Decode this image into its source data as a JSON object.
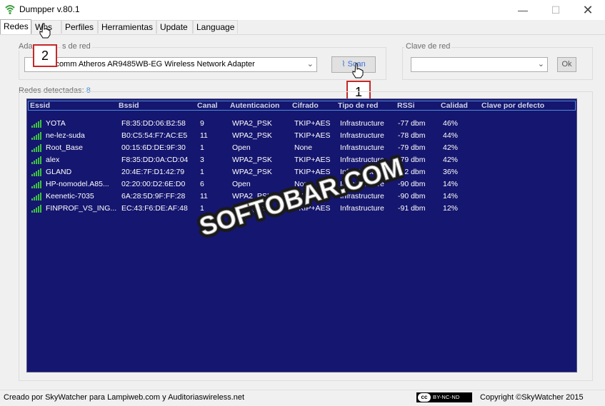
{
  "window": {
    "title": "Dumpper v.80.1",
    "min_glyph": "—",
    "max_glyph": "☐",
    "close_glyph": "✕"
  },
  "tabs": [
    {
      "label": "Redes",
      "active": true
    },
    {
      "label": "Wps",
      "active": false
    },
    {
      "label": "Perfiles",
      "active": false
    },
    {
      "label": "Herramientas",
      "active": false
    },
    {
      "label": "Update",
      "active": false
    },
    {
      "label": "Language",
      "active": false
    }
  ],
  "adapter": {
    "group_label": "Adaptadores de red",
    "group_label_visible": "Ada",
    "group_label_visible_tail": "s de red",
    "selected_value": "lcomm Atheros AR9485WB-EG Wireless Network Adapter",
    "scan_label": "Scan"
  },
  "key": {
    "group_label": "Clave de red",
    "selected_value": "",
    "ok_label": "Ok"
  },
  "callouts": {
    "first": "1",
    "second": "2"
  },
  "networks": {
    "label": "Redes detectadas:",
    "count": "8",
    "columns": [
      "Essid",
      "Bssid",
      "Canal",
      "Autenticacion",
      "Cifrado",
      "Tipo de red",
      "RSSi",
      "Calidad",
      "Clave por defecto"
    ],
    "rows": [
      {
        "essid": "YOTA",
        "bssid": "F8:35:DD:06:B2:58",
        "canal": "9",
        "auth": "WPA2_PSK",
        "cifrado": "TKIP+AES",
        "tipo": "Infrastructure",
        "rssi": "-77 dbm",
        "calidad": "46%",
        "clave": ""
      },
      {
        "essid": "ne-lez-suda",
        "bssid": "B0:C5:54:F7:AC:E5",
        "canal": "11",
        "auth": "WPA2_PSK",
        "cifrado": "TKIP+AES",
        "tipo": "Infrastructure",
        "rssi": "-78 dbm",
        "calidad": "44%",
        "clave": ""
      },
      {
        "essid": "Root_Base",
        "bssid": "00:15:6D:DE:9F:30",
        "canal": "1",
        "auth": "Open",
        "cifrado": "None",
        "tipo": "Infrastructure",
        "rssi": "-79 dbm",
        "calidad": "42%",
        "clave": ""
      },
      {
        "essid": "alex",
        "bssid": "F8:35:DD:0A:CD:04",
        "canal": "3",
        "auth": "WPA2_PSK",
        "cifrado": "TKIP+AES",
        "tipo": "Infrastructure",
        "rssi": "-79 dbm",
        "calidad": "42%",
        "clave": ""
      },
      {
        "essid": "GLAND",
        "bssid": "20:4E:7F:D1:42:79",
        "canal": "1",
        "auth": "WPA2_PSK",
        "cifrado": "TKIP+AES",
        "tipo": "Infrastructure",
        "rssi": "-82 dbm",
        "calidad": "36%",
        "clave": ""
      },
      {
        "essid": "HP-nomodel.A85...",
        "bssid": "02:20:00:D2:6E:D0",
        "canal": "6",
        "auth": "Open",
        "cifrado": "None",
        "tipo": "Infrastructure",
        "rssi": "-90 dbm",
        "calidad": "14%",
        "clave": ""
      },
      {
        "essid": "Keenetic-7035",
        "bssid": "6A:28:5D:9F:FF:28",
        "canal": "11",
        "auth": "WPA2_PSK",
        "cifrado": "TKIP+AES",
        "tipo": "Infrastructure",
        "rssi": "-90 dbm",
        "calidad": "14%",
        "clave": ""
      },
      {
        "essid": "FINPROF_VS_ING...",
        "bssid": "EC:43:F6:DE:AF:48",
        "canal": "1",
        "auth": "WPA2_PSK",
        "cifrado": "TKIP+AES",
        "tipo": "Infrastructure",
        "rssi": "-91 dbm",
        "calidad": "12%",
        "clave": ""
      }
    ],
    "signal_color": "#3cc43c",
    "panel_color": "#15166f"
  },
  "watermark": "SOFTOBAR.COM",
  "status": {
    "left": "Creado por SkyWatcher para Lampiweb.com y Auditoriaswireless.net",
    "license_cc": "cc",
    "license_label": "BY-NC-ND",
    "right": "Copyright ©SkyWatcher 2015"
  }
}
